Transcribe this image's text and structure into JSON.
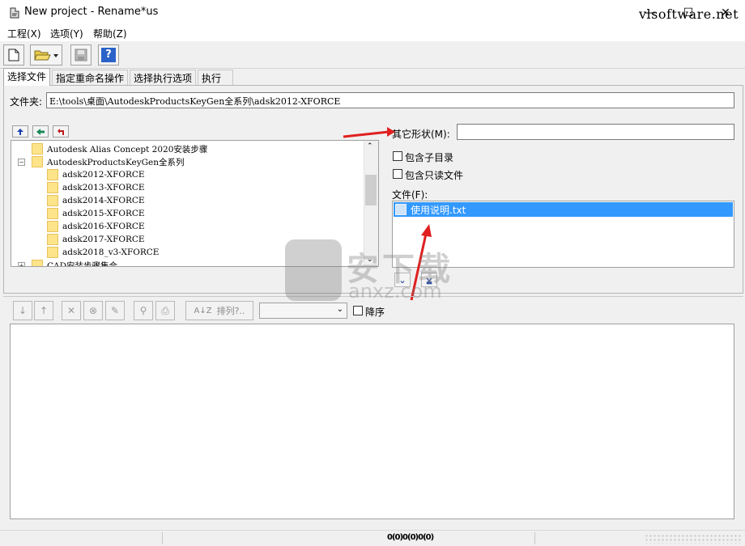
{
  "window": {
    "title": "New project - Rename*us",
    "minimize": "—",
    "maximize": "☐",
    "close": "✕"
  },
  "menu": [
    "工程(X)",
    "选项(Y)",
    "帮助(Z)"
  ],
  "toolbar": {
    "brand": "vlsoftware.net",
    "help_label": "?"
  },
  "tabs": [
    "选择文件",
    "指定重命名操作",
    "选择执行选项",
    "执行"
  ],
  "folder": {
    "label": "文件夹:",
    "path": "E:\\tools\\桌面\\AutodeskProductsKeyGen全系列\\adsk2012-XFORCE"
  },
  "tree": {
    "items": [
      {
        "label": "Autodesk Alias Concept 2020安装步骤",
        "expander": ""
      },
      {
        "label": "AutodeskProductsKeyGen全系列",
        "expander": "−"
      },
      {
        "label": "adsk2012-XFORCE",
        "expander": ""
      },
      {
        "label": "adsk2013-XFORCE",
        "expander": ""
      },
      {
        "label": "adsk2014-XFORCE",
        "expander": ""
      },
      {
        "label": "adsk2015-XFORCE",
        "expander": ""
      },
      {
        "label": "adsk2016-XFORCE",
        "expander": ""
      },
      {
        "label": "adsk2017-XFORCE",
        "expander": ""
      },
      {
        "label": "adsk2018_v3-XFORCE",
        "expander": ""
      },
      {
        "label": "CAD安装步骤集合",
        "expander": "+"
      }
    ]
  },
  "options": {
    "other_shape_label": "其它形状(M):",
    "other_shape_value": "",
    "include_subdirs": "包含子目录",
    "include_readonly": "包含只读文件",
    "files_label": "文件(F):",
    "files": [
      "使用说明.txt"
    ]
  },
  "lower_toolbar": {
    "sort_label": "排列?..",
    "sort_select_value": "",
    "descending_label": "降序"
  },
  "status": {
    "text": "0(0)0(0)0(0)"
  },
  "watermark": {
    "text1": "安下载",
    "text2": "anxz.com"
  },
  "colors": {
    "selection": "#3399ff",
    "arrow": "#e02020"
  }
}
